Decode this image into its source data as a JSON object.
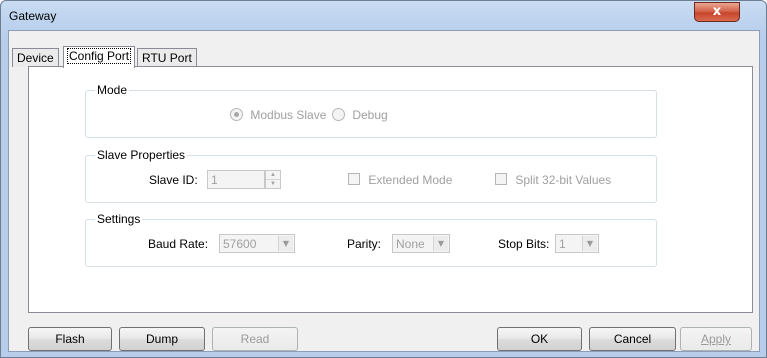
{
  "window": {
    "title": "Gateway",
    "close_glyph": "x"
  },
  "tabs": [
    {
      "label": "Device",
      "active": false
    },
    {
      "label": "Config Port",
      "active": true
    },
    {
      "label": "RTU Port",
      "active": false
    }
  ],
  "mode": {
    "group_label": "Mode",
    "options": [
      {
        "label": "Modbus Slave",
        "selected": true
      },
      {
        "label": "Debug",
        "selected": false
      }
    ]
  },
  "slave": {
    "group_label": "Slave Properties",
    "slave_id_label": "Slave ID:",
    "slave_id_value": "1",
    "extended_mode_label": "Extended Mode",
    "extended_mode_checked": false,
    "split_label": "Split 32-bit Values",
    "split_checked": false
  },
  "settings": {
    "group_label": "Settings",
    "baud_label": "Baud Rate:",
    "baud_value": "57600",
    "parity_label": "Parity:",
    "parity_value": "None",
    "stop_label": "Stop Bits:",
    "stop_value": "1"
  },
  "buttons": {
    "flash": "Flash",
    "dump": "Dump",
    "read": "Read",
    "ok": "OK",
    "cancel": "Cancel",
    "apply": "Apply"
  },
  "colors": {
    "titlebar": "#bcd2ee",
    "close_button": "#c7452b",
    "disabled_text": "#a0a0a0",
    "dialog_bg": "#f0f0f0"
  },
  "icons": [
    "close-icon",
    "spin-up-icon",
    "spin-down-icon",
    "dropdown-arrow-icon"
  ]
}
